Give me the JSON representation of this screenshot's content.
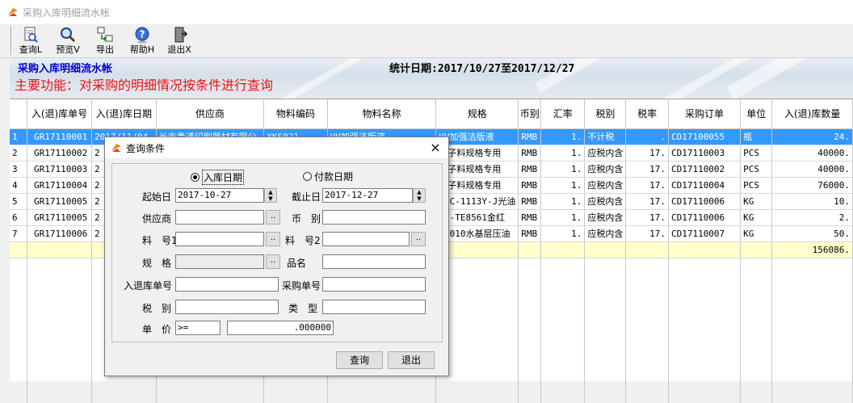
{
  "window": {
    "title": "采购入库明细流水帐"
  },
  "toolbar": {
    "query": "查询L",
    "preview": "预览V",
    "export": "导出",
    "help": "帮助H",
    "exit": "退出X"
  },
  "banner": {
    "title": "采购入库明细流水帐",
    "function_text": "主要功能：对采购的明细情况按条件进行查询",
    "stat_label": "统计日期:",
    "stat_range": "2017/10/27至2017/12/27"
  },
  "table": {
    "headers": [
      "",
      "入(退)库单号",
      "入(退)库日期",
      "供应商",
      "物料编码",
      "物料名称",
      "规格",
      "币别",
      "汇率",
      "税别",
      "税率",
      "采购订单",
      "单位",
      "入(退)库数量"
    ],
    "rows": [
      [
        "1",
        "GR17110001",
        "2017/11/04",
        "长市贵通印刷器材有限公",
        "YKS021",
        "UV加强洁版液",
        "UV加强洁版液",
        "RMB",
        "1.",
        "不计税",
        ".",
        "CD17100055",
        "瓶",
        "24."
      ],
      [
        "2",
        "GR17110002",
        "2",
        "",
        "",
        "",
        "电子料规格专用",
        "RMB",
        "1.",
        "应税内含",
        "17.",
        "CD17110003",
        "PCS",
        "40000."
      ],
      [
        "3",
        "GR17110003",
        "2",
        "",
        "",
        "",
        "电子料规格专用",
        "RMB",
        "1.",
        "应税内含",
        "17.",
        "CD17110002",
        "PCS",
        "40000."
      ],
      [
        "4",
        "GR17110004",
        "2",
        "",
        "",
        "",
        "电子料规格专用",
        "RMB",
        "1.",
        "应税内含",
        "17.",
        "CD17110004",
        "PCS",
        "76000."
      ],
      [
        "5",
        "GR17110005",
        "2",
        "",
        "",
        "",
        "UVC-1113Y-J光油",
        "RMB",
        "1.",
        "应税内含",
        "17.",
        "CD17110006",
        "KG",
        "10."
      ],
      [
        "6",
        "GR17110005",
        "2",
        "",
        "",
        "",
        "UV-TE8561金红",
        "RMB",
        "1.",
        "应税内含",
        "17.",
        "CD17110006",
        "KG",
        "2."
      ],
      [
        "7",
        "GR17110006",
        "2",
        "",
        "",
        "",
        "-9010水基层压油",
        "RMB",
        "1.",
        "应税内含",
        "17.",
        "CD17110007",
        "KG",
        "50."
      ]
    ],
    "total": "156086."
  },
  "dialog": {
    "title": "查询条件",
    "close": "×",
    "radio_in_date": "入库日期",
    "radio_pay_date": "付款日期",
    "start_label": "起始日",
    "start_value": "2017-10-27",
    "end_label": "截止日",
    "end_value": "2017-12-27",
    "supplier_label": "供应商",
    "currency_label": "币　别",
    "material1_label": "料　号1",
    "material2_label": "料　号2",
    "spec_label": "规　格",
    "name_label": "品名",
    "in_no_label": "入退库单号",
    "po_label": "采购单号",
    "tax_label": "税　别",
    "type_label": "类　型",
    "price_label": "单　价",
    "price_op": ">=",
    "price_value": ".000000",
    "ellipsis": "..",
    "query_btn": "查询",
    "exit_btn": "退出"
  },
  "colors": {
    "selection": "#3399ff",
    "banner_title": "#0000cc",
    "function_text": "#ee1111",
    "total_row": "#ffffcc"
  }
}
